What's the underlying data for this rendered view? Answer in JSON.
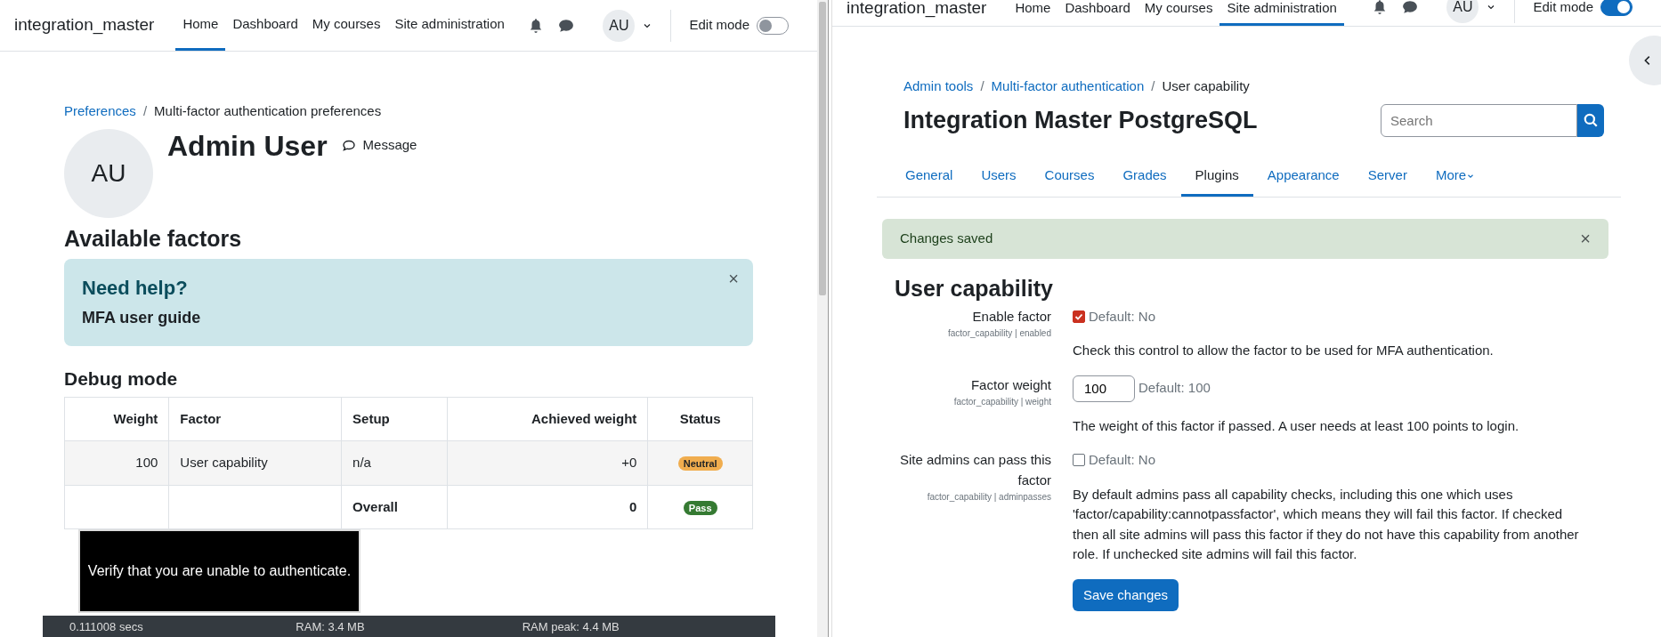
{
  "left_window": {
    "navbar": {
      "brand": "integration_master",
      "items": [
        {
          "label": "Home",
          "selected": true
        },
        {
          "label": "Dashboard",
          "selected": false
        },
        {
          "label": "My courses",
          "selected": false
        },
        {
          "label": "Site administration",
          "selected": false
        }
      ],
      "user_initials": "AU",
      "edit_mode": {
        "label": "Edit mode",
        "on": false
      }
    },
    "breadcrumb": {
      "separator": "/",
      "items": [
        {
          "label": "Preferences",
          "link": true
        },
        {
          "label": "Multi-factor authentication preferences",
          "link": false
        }
      ]
    },
    "profile": {
      "initials": "AU",
      "name": "Admin User",
      "message": "Message"
    },
    "section_title": "Available factors",
    "help_alert": {
      "title": "Need help?",
      "link": "MFA user guide",
      "close": "×"
    },
    "debug_title": "Debug mode",
    "table": {
      "columns": [
        "Weight",
        "Factor",
        "Setup",
        "Achieved weight",
        "Status"
      ],
      "rows": [
        {
          "cells": [
            "100",
            "User capability",
            "n/a",
            "+0"
          ],
          "bold": false,
          "status": {
            "label": "Neutral",
            "kind": "neutral"
          }
        },
        {
          "cells": [
            "",
            "",
            "Overall",
            "0"
          ],
          "bold": true,
          "status": {
            "label": "Pass",
            "kind": "pass"
          }
        }
      ]
    },
    "tooltip": "Verify that you are unable to authenticate.",
    "footer": [
      "0.111008 secs",
      "RAM: 3.4 MB",
      "RAM peak: 4.4 MB"
    ]
  },
  "right_window": {
    "navbar": {
      "brand": "integration_master",
      "items": [
        {
          "label": "Home",
          "selected": false
        },
        {
          "label": "Dashboard",
          "selected": false
        },
        {
          "label": "My courses",
          "selected": false
        },
        {
          "label": "Site administration",
          "selected": true
        }
      ],
      "user_initials": "AU",
      "edit_mode": {
        "label": "Edit mode",
        "on": true
      }
    },
    "breadcrumb": {
      "separator": "/",
      "items": [
        {
          "label": "Admin tools",
          "link": true
        },
        {
          "label": "Multi-factor authentication",
          "link": true
        },
        {
          "label": "User capability",
          "link": false
        }
      ]
    },
    "site_title": "Integration Master PostgreSQL",
    "search": {
      "placeholder": "Search"
    },
    "tabs": [
      {
        "label": "General",
        "selected": false
      },
      {
        "label": "Users",
        "selected": false
      },
      {
        "label": "Courses",
        "selected": false
      },
      {
        "label": "Grades",
        "selected": false
      },
      {
        "label": "Plugins",
        "selected": true
      },
      {
        "label": "Appearance",
        "selected": false
      },
      {
        "label": "Server",
        "selected": false
      },
      {
        "label": "More",
        "selected": false
      }
    ],
    "alert": {
      "text": "Changes saved",
      "close": "×"
    },
    "heading": "User capability",
    "settings": [
      {
        "kind": "checkbox",
        "label": "Enable factor",
        "key": "factor_capability | enabled",
        "checked": true,
        "default": "Default: No",
        "description": "Check this control to allow the factor to be used for MFA authentication."
      },
      {
        "kind": "text",
        "label": "Factor weight",
        "key": "factor_capability | weight",
        "value": "100",
        "default": "Default: 100",
        "description": "The weight of this factor if passed. A user needs at least 100 points to login."
      },
      {
        "kind": "checkbox",
        "label": "Site admins can pass this factor",
        "key": "factor_capability | adminpasses",
        "checked": false,
        "default": "Default: No",
        "description": "By default admins pass all capability checks, including this one which uses 'factor/capability:cannotpassfactor', which means they will fail this factor. If checked then all site admins will pass this factor if they do not have this capability from another role. If unchecked site admins will fail this factor."
      }
    ],
    "save_button": "Save changes"
  }
}
